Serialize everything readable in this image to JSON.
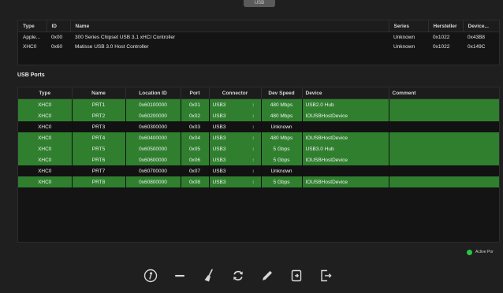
{
  "top_tab_label": "USB",
  "controllers": {
    "columns": [
      "Type",
      "ID",
      "Name",
      "Series",
      "Hersteller",
      "Device..."
    ],
    "rows": [
      {
        "type": "Apple...",
        "id": "0x00",
        "name": "300 Series Chipset USB 3.1 xHCI Controller",
        "series": "Unknown",
        "vendor": "0x1022",
        "device": "0x43B8"
      },
      {
        "type": "XHC0",
        "id": "0x60",
        "name": "Matisse USB 3.0 Host Controller",
        "series": "Unknown",
        "vendor": "0x1022",
        "device": "0x149C"
      }
    ]
  },
  "usb_ports": {
    "title": "USB Ports",
    "columns": [
      "Type",
      "Name",
      "Location ID",
      "Port",
      "Connector",
      "Dev Speed",
      "Device",
      "Comment"
    ],
    "rows": [
      {
        "active": true,
        "type": "XHC0",
        "name": "PRT1",
        "location": "0x60100000",
        "port": "0x01",
        "connector": "USB3",
        "speed": "480 Mbps",
        "device": "USB2.0 Hub",
        "comment": ""
      },
      {
        "active": true,
        "type": "XHC0",
        "name": "PRT2",
        "location": "0x60200000",
        "port": "0x02",
        "connector": "USB3",
        "speed": "480 Mbps",
        "device": "IOUSBHostDevice",
        "comment": ""
      },
      {
        "active": false,
        "type": "XHC0",
        "name": "PRT3",
        "location": "0x60300000",
        "port": "0x03",
        "connector": "USB3",
        "speed": "Unknown",
        "device": "",
        "comment": ""
      },
      {
        "active": true,
        "type": "XHC0",
        "name": "PRT4",
        "location": "0x60400000",
        "port": "0x04",
        "connector": "USB3",
        "speed": "480 Mbps",
        "device": "IOUSBHostDevice",
        "comment": ""
      },
      {
        "active": true,
        "type": "XHC0",
        "name": "PRT5",
        "location": "0x60500000",
        "port": "0x05",
        "connector": "USB3",
        "speed": "5 Gbps",
        "device": "USB3.0 Hub",
        "comment": ""
      },
      {
        "active": true,
        "type": "XHC0",
        "name": "PRT6",
        "location": "0x60600000",
        "port": "0x06",
        "connector": "USB3",
        "speed": "5 Gbps",
        "device": "IOUSBHostDevice",
        "comment": ""
      },
      {
        "active": false,
        "type": "XHC0",
        "name": "PRT7",
        "location": "0x60700000",
        "port": "0x07",
        "connector": "USB3",
        "speed": "Unknown",
        "device": "",
        "comment": ""
      },
      {
        "active": true,
        "type": "XHC0",
        "name": "PRT8",
        "location": "0x60800000",
        "port": "0x08",
        "connector": "USB3",
        "speed": "5 Gbps",
        "device": "IOUSBHostDevice",
        "comment": ""
      }
    ]
  },
  "legend": {
    "label": "Active Por",
    "color": "#27c93f"
  },
  "colors": {
    "active_row": "#2f7f2f",
    "background": "#1f1f1f",
    "panel": "#141414"
  },
  "toolbar": {
    "icons": [
      "info-icon",
      "minus-icon",
      "broom-icon",
      "refresh-icon",
      "pencil-icon",
      "import-icon",
      "export-icon"
    ]
  }
}
